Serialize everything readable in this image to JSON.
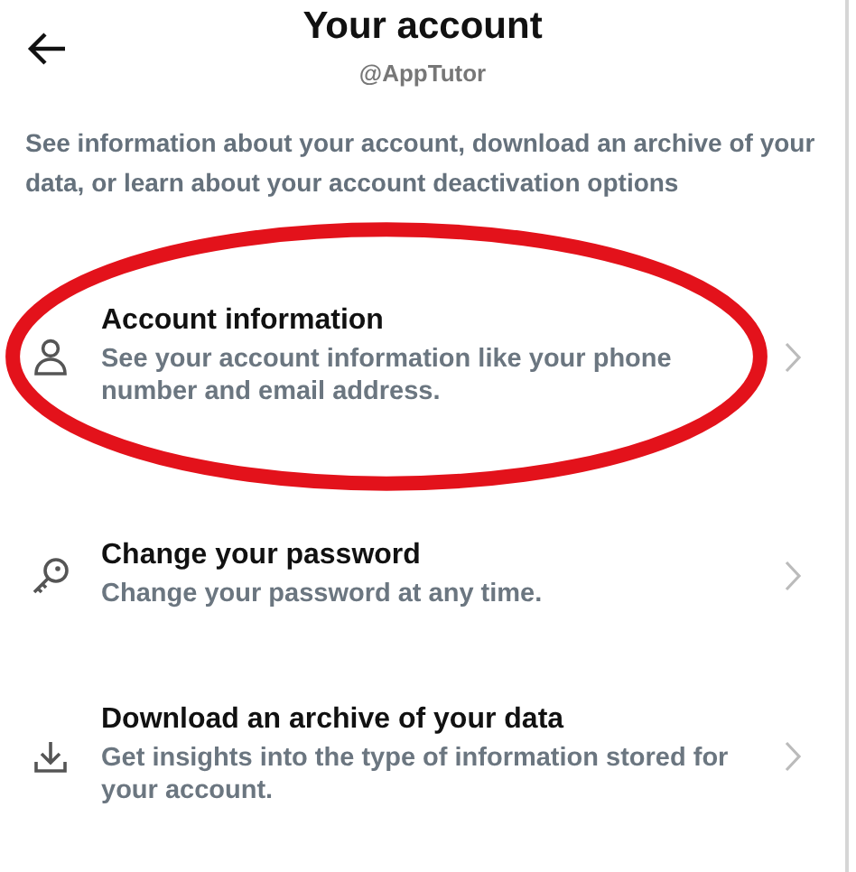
{
  "header": {
    "title": "Your account",
    "handle": "@AppTutor"
  },
  "intro": "See information about your account, download an archive of your data, or learn about your account deactivation options",
  "items": [
    {
      "kind": "person",
      "title": "Account information",
      "description": "See your account information like your phone number and email address.",
      "highlighted": true
    },
    {
      "kind": "key",
      "title": "Change your password",
      "description": "Change your password at any time.",
      "highlighted": false
    },
    {
      "kind": "download",
      "title": "Download an archive of your data",
      "description": "Get insights into the type of information stored for your account.",
      "highlighted": false
    }
  ]
}
